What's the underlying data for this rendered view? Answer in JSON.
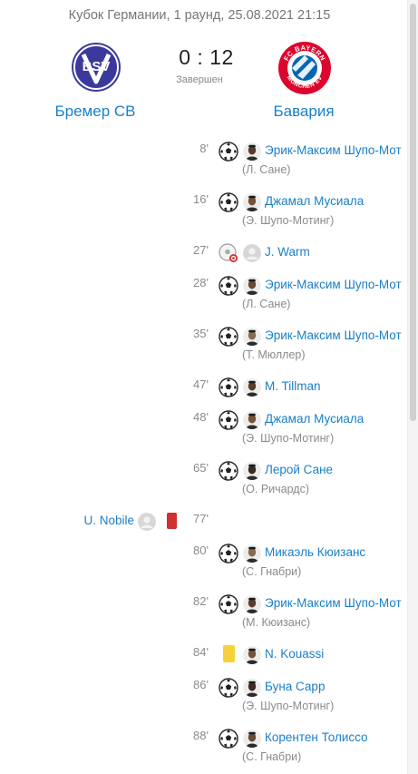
{
  "match": {
    "header": "Кубок Германии, 1 раунд, 25.08.2021 21:15",
    "score": "0 : 12",
    "status": "Завершен",
    "home": {
      "name": "Бремер СВ",
      "logo_text": "BSV"
    },
    "away": {
      "name": "Бавария",
      "logo_text_top": "FC BAYERN",
      "logo_text_bottom": "MÜNCHEN EV"
    }
  },
  "colors": {
    "link": "#1a7fc8",
    "muted": "#8a8a8a",
    "red_card": "#d32f2f",
    "yellow_card": "#f5d23a",
    "bremer_blue": "#3b3a9c",
    "bayern_red": "#dc052d"
  },
  "events": [
    {
      "minute": "8'",
      "type": "goal",
      "player": "Эрик-Максим Шупо-Мот",
      "assist": "(Л. Сане)"
    },
    {
      "minute": "16'",
      "type": "goal",
      "player": "Джамал Мусиала",
      "assist": "(Э. Шупо-Мотинг)"
    },
    {
      "minute": "27'",
      "type": "own-goal",
      "player": "J. Warm",
      "assist": ""
    },
    {
      "minute": "28'",
      "type": "goal",
      "player": "Эрик-Максим Шупо-Мот",
      "assist": "(Л. Сане)"
    },
    {
      "minute": "35'",
      "type": "goal",
      "player": "Эрик-Максим Шупо-Мот",
      "assist": "(Т. Мюллер)"
    },
    {
      "minute": "47'",
      "type": "goal",
      "player": "M. Tillman",
      "assist": ""
    },
    {
      "minute": "48'",
      "type": "goal",
      "player": "Джамал Мусиала",
      "assist": "(Э. Шупо-Мотинг)"
    },
    {
      "minute": "65'",
      "type": "goal",
      "player": "Лерой Сане",
      "assist": "(О. Ричардс)"
    },
    {
      "minute": "77'",
      "type": "red-card-home",
      "player": "U. Nobile",
      "assist": ""
    },
    {
      "minute": "80'",
      "type": "goal",
      "player": "Микаэль Кюизанс",
      "assist": "(С. Гнабри)"
    },
    {
      "minute": "82'",
      "type": "goal",
      "player": "Эрик-Максим Шупо-Мот",
      "assist": "(М. Кюизанс)"
    },
    {
      "minute": "84'",
      "type": "yellow-card",
      "player": "N. Kouassi",
      "assist": ""
    },
    {
      "minute": "86'",
      "type": "goal",
      "player": "Буна Сарр",
      "assist": "(Э. Шупо-Мотинг)"
    },
    {
      "minute": "88'",
      "type": "goal",
      "player": "Корентен Толиссо",
      "assist": "(С. Гнабри)"
    }
  ]
}
